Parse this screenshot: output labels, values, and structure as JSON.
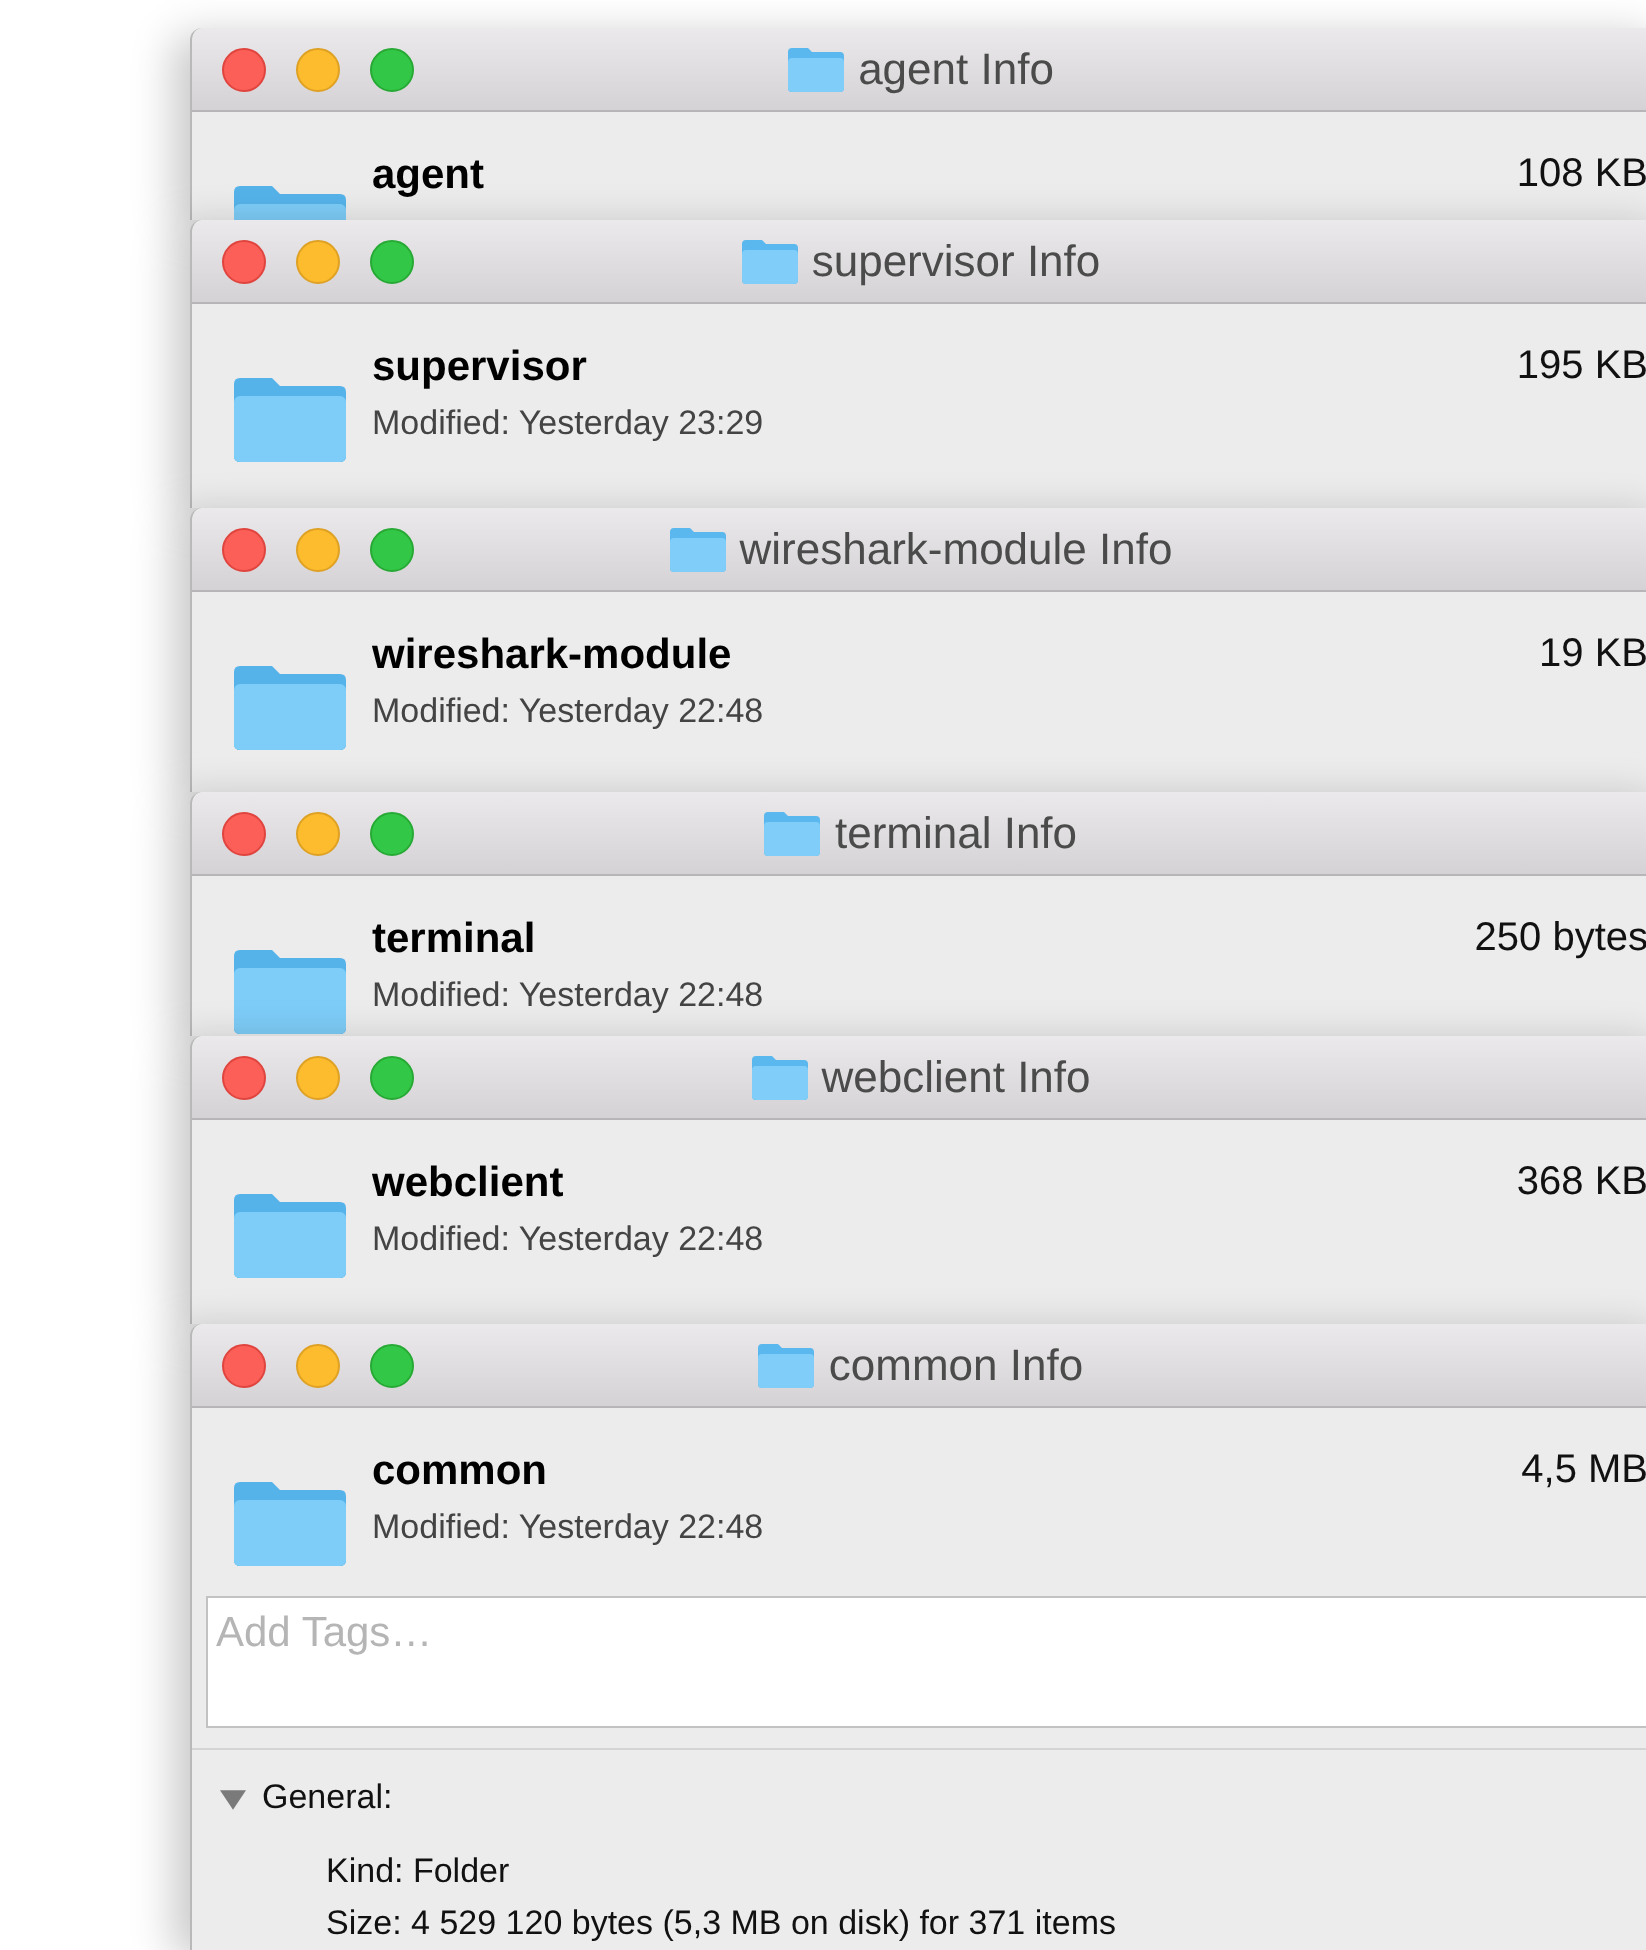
{
  "windows": [
    {
      "title": "agent Info",
      "name": "agent",
      "size": "108 KB"
    },
    {
      "title": "supervisor Info",
      "name": "supervisor",
      "size": "195 KB",
      "modified": "Modified: Yesterday 23:29"
    },
    {
      "title": "wireshark-module Info",
      "name": "wireshark-module",
      "size": "19 KB",
      "modified": "Modified: Yesterday 22:48"
    },
    {
      "title": "terminal Info",
      "name": "terminal",
      "size": "250 bytes",
      "modified": "Modified: Yesterday 22:48"
    },
    {
      "title": "webclient Info",
      "name": "webclient",
      "size": "368 KB",
      "modified": "Modified: Yesterday 22:48"
    },
    {
      "title": "common Info",
      "name": "common",
      "size": "4,5 MB",
      "modified": "Modified: Yesterday 22:48",
      "tags": {
        "placeholder": "Add Tags…"
      },
      "general": {
        "label": "General:",
        "expanded": true,
        "kind": "Kind: Folder",
        "size": "Size: 4 529 120 bytes (5,3 MB on disk) for 371 items"
      }
    }
  ]
}
